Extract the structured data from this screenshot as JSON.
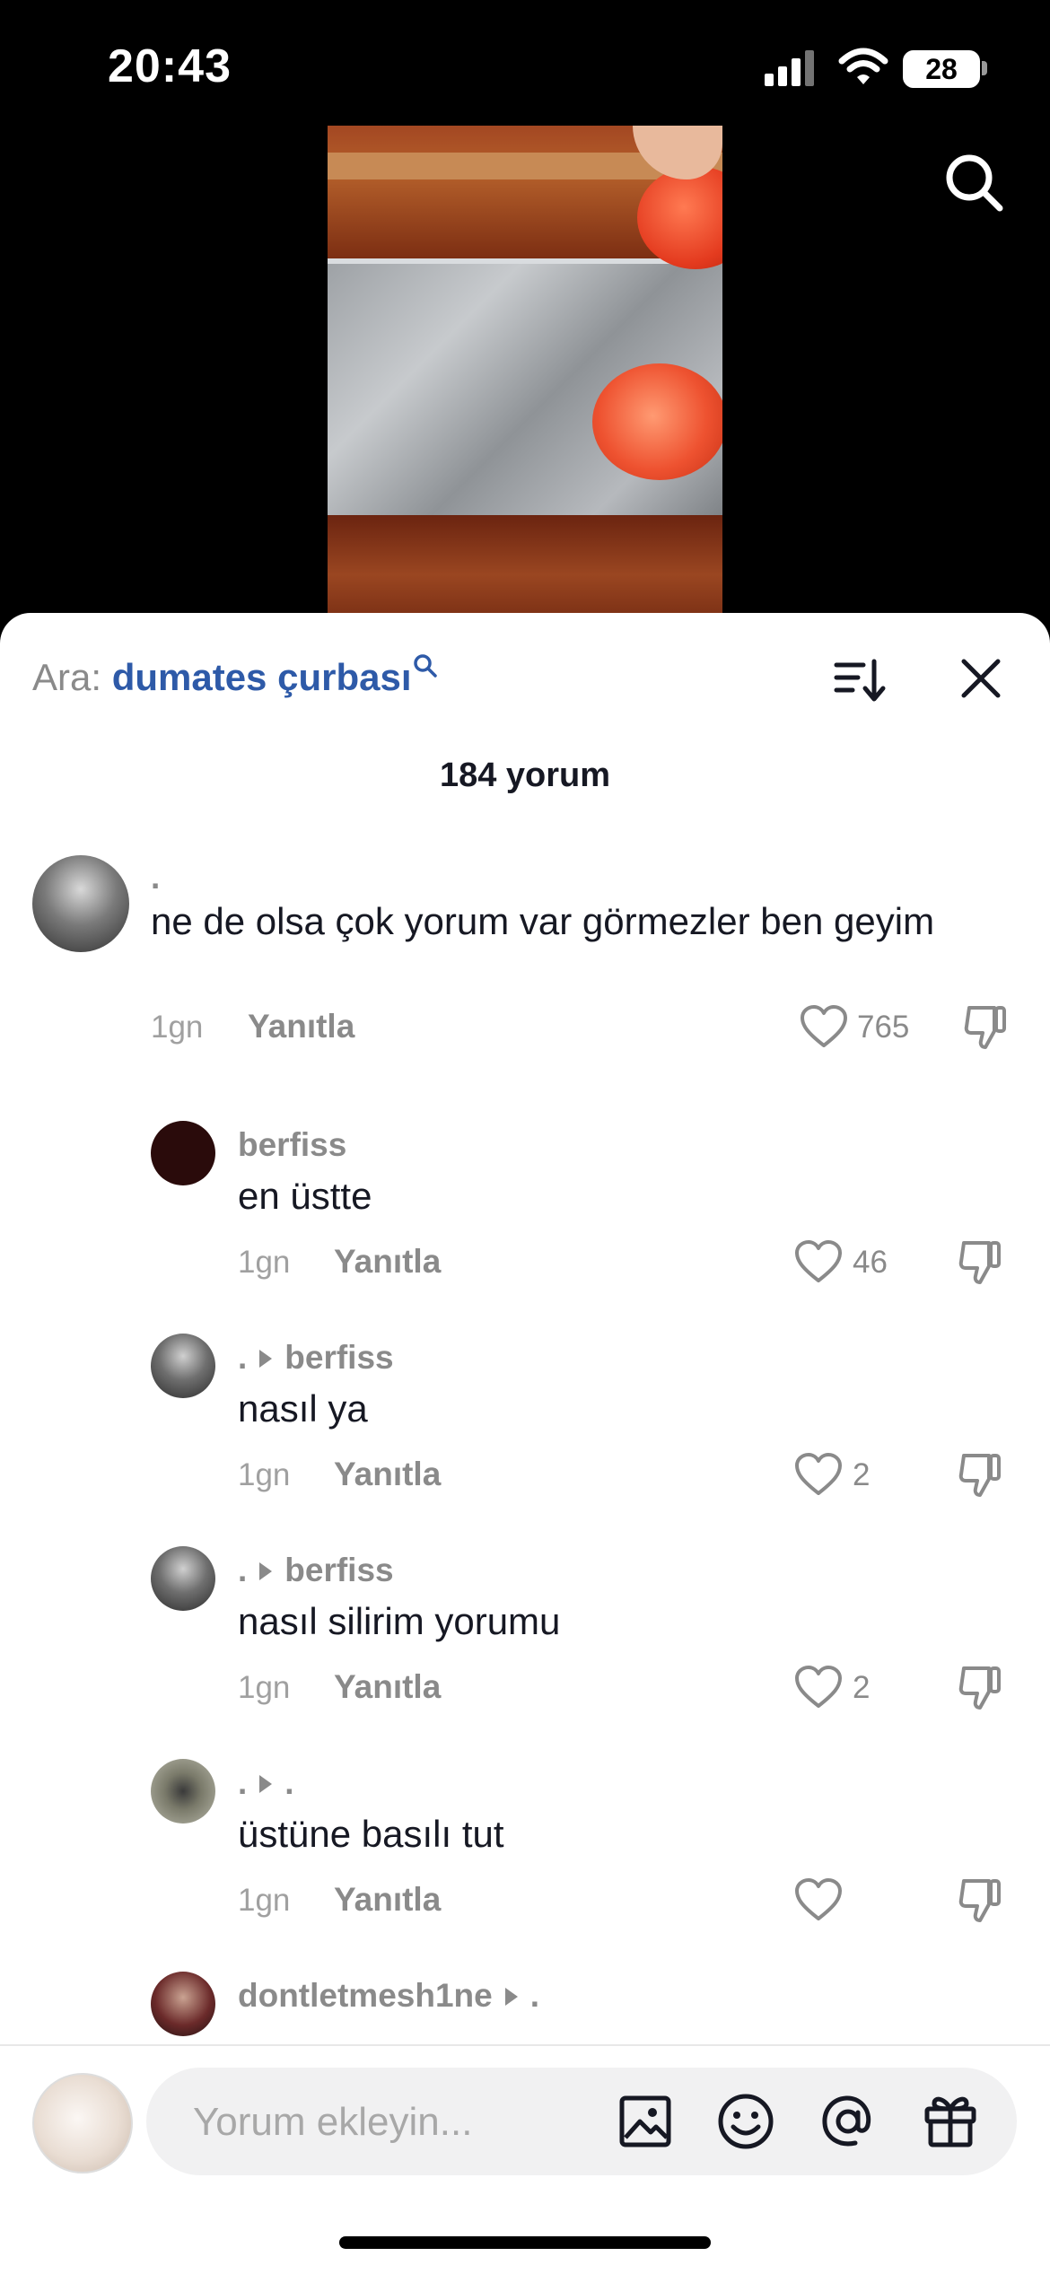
{
  "status_bar": {
    "time": "20:43",
    "battery": "28"
  },
  "sheet": {
    "search_prefix": "Ara: ",
    "search_term": "dumates çurbası",
    "comment_count": "184 yorum"
  },
  "comments": [
    {
      "author": ".",
      "text": "ne de olsa çok yorum var görmezler ben geyim",
      "time": "1gn",
      "reply": "Yanıtla",
      "likes": "765"
    },
    {
      "author": "berfiss",
      "text": "en üstte",
      "time": "1gn",
      "reply": "Yanıtla",
      "likes": "46"
    },
    {
      "author": ".",
      "reply_to": "berfiss",
      "text": "nasıl ya",
      "time": "1gn",
      "reply": "Yanıtla",
      "likes": "2"
    },
    {
      "author": ".",
      "reply_to": "berfiss",
      "text": "nasıl silirim yorumu",
      "time": "1gn",
      "reply": "Yanıtla",
      "likes": "2"
    },
    {
      "author": ".",
      "reply_to": ".",
      "text": "üstüne basılı tut",
      "time": "1gn",
      "reply": "Yanıtla",
      "likes": ""
    },
    {
      "author": "dontletmesh1ne",
      "reply_to": "."
    }
  ],
  "composer": {
    "placeholder": "Yorum ekleyin..."
  },
  "icons": [
    "signal-icon",
    "wifi-icon",
    "battery-icon",
    "search-icon",
    "sort-icon",
    "close-icon",
    "heart-icon",
    "dislike-icon",
    "image-icon",
    "emoji-icon",
    "mention-icon",
    "gift-icon"
  ]
}
